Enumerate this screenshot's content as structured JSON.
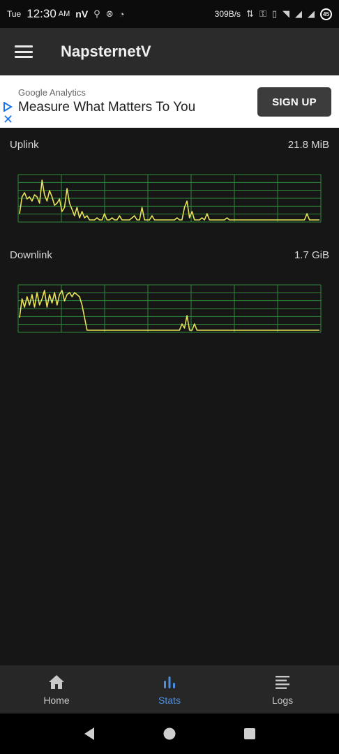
{
  "status_bar": {
    "day": "Tue",
    "time": "12:30",
    "ampm": "AM",
    "app_badge": "nV",
    "net_speed": "309B/s",
    "battery": "45"
  },
  "app_bar": {
    "title": "NapsternetV"
  },
  "ad": {
    "sponsor": "Google Analytics",
    "headline": "Measure What Matters To You",
    "cta": "SIGN UP"
  },
  "stats": {
    "uplink": {
      "label": "Uplink",
      "value": "21.8 MiB"
    },
    "downlink": {
      "label": "Downlink",
      "value": "1.7 GiB"
    }
  },
  "chart_data": [
    {
      "type": "line",
      "title": "",
      "series": [
        {
          "values": [
            0.15,
            0.55,
            0.65,
            0.5,
            0.55,
            0.45,
            0.6,
            0.55,
            0.4,
            0.95,
            0.6,
            0.45,
            0.7,
            0.55,
            0.35,
            0.4,
            0.5,
            0.2,
            0.3,
            0.75,
            0.4,
            0.25,
            0.1,
            0.3,
            0.05,
            0.2,
            0.05,
            0.1,
            0.0,
            0.0,
            0.0,
            0.05,
            0.0,
            0.0,
            0.15,
            0.0,
            0.0,
            0.05,
            0.0,
            0.0,
            0.1,
            0.0,
            0.0,
            0.0,
            0.0,
            0.05,
            0.1,
            0.0,
            0.0,
            0.3,
            0.0,
            0.0,
            0.0,
            0.1,
            0.0,
            0.0,
            0.0,
            0.0,
            0.0,
            0.0,
            0.0,
            0.0,
            0.0,
            0.05,
            0.0,
            0.0,
            0.3,
            0.45,
            0.05,
            0.2,
            0.0,
            0.0,
            0.0,
            0.05,
            0.0,
            0.15,
            0.0,
            0.0,
            0.0,
            0.0,
            0.0,
            0.0,
            0.0,
            0.05,
            0.0,
            0.0,
            0.0,
            0.0,
            0.0,
            0.0,
            0.0,
            0.0,
            0.0,
            0.0,
            0.0,
            0.0,
            0.0,
            0.0,
            0.0,
            0.0,
            0.0,
            0.0,
            0.0,
            0.0,
            0.0,
            0.0,
            0.0,
            0.0,
            0.0,
            0.0,
            0.0,
            0.0,
            0.0,
            0.0,
            0.0,
            0.15,
            0.0,
            0.0,
            0.0,
            0.0,
            0.0
          ]
        }
      ],
      "grid": true,
      "color": "#e8e25a",
      "grid_color": "#2f8a3a"
    },
    {
      "type": "line",
      "title": "",
      "series": [
        {
          "values": [
            0.3,
            0.75,
            0.55,
            0.8,
            0.6,
            0.85,
            0.55,
            0.9,
            0.6,
            0.75,
            0.95,
            0.55,
            0.85,
            0.65,
            0.9,
            0.6,
            0.85,
            0.95,
            0.7,
            0.85,
            0.9,
            0.8,
            0.9,
            0.85,
            0.8,
            0.6,
            0.3,
            0.0,
            0.0,
            0.0,
            0.0,
            0.0,
            0.0,
            0.0,
            0.0,
            0.0,
            0.0,
            0.0,
            0.0,
            0.0,
            0.0,
            0.0,
            0.0,
            0.0,
            0.0,
            0.0,
            0.0,
            0.0,
            0.0,
            0.0,
            0.0,
            0.0,
            0.0,
            0.0,
            0.0,
            0.0,
            0.0,
            0.0,
            0.0,
            0.0,
            0.0,
            0.0,
            0.0,
            0.0,
            0.0,
            0.15,
            0.05,
            0.35,
            0.0,
            0.0,
            0.15,
            0.0,
            0.0,
            0.0,
            0.0,
            0.0,
            0.0,
            0.0,
            0.0,
            0.0,
            0.0,
            0.0,
            0.0,
            0.0,
            0.0,
            0.0,
            0.0,
            0.0,
            0.0,
            0.0,
            0.0,
            0.0,
            0.0,
            0.0,
            0.0,
            0.0,
            0.0,
            0.0,
            0.0,
            0.0,
            0.0,
            0.0,
            0.0,
            0.0,
            0.0,
            0.0,
            0.0,
            0.0,
            0.0,
            0.0,
            0.0,
            0.0,
            0.0,
            0.0,
            0.0,
            0.0,
            0.0,
            0.0,
            0.0,
            0.0,
            0.0
          ]
        }
      ],
      "grid": true,
      "color": "#e8e25a",
      "grid_color": "#2f8a3a"
    }
  ],
  "bottom_nav": {
    "items": [
      {
        "label": "Home",
        "icon": "home-icon",
        "active": false
      },
      {
        "label": "Stats",
        "icon": "bar-chart-icon",
        "active": true
      },
      {
        "label": "Logs",
        "icon": "list-icon",
        "active": false
      }
    ]
  }
}
